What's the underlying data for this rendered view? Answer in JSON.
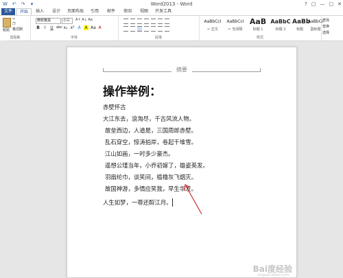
{
  "window": {
    "title": "Word2013 - Word",
    "qat": [
      "W",
      "↶",
      "↷",
      "▾"
    ],
    "controls": [
      "?",
      "▢",
      "—",
      "▢",
      "✕"
    ]
  },
  "tabs": [
    {
      "label": "文件",
      "kind": "file"
    },
    {
      "label": "开始",
      "kind": "active"
    },
    {
      "label": "插入"
    },
    {
      "label": "设计"
    },
    {
      "label": "页面布局"
    },
    {
      "label": "引用"
    },
    {
      "label": "邮件"
    },
    {
      "label": "审阅"
    },
    {
      "label": "视图"
    },
    {
      "label": "开发工具"
    }
  ],
  "ribbon": {
    "clipboard": {
      "paste": "粘贴",
      "cut": "✂",
      "copy": "❐",
      "format_painter": "格式刷",
      "group": "剪贴板"
    },
    "font": {
      "name": "微软雅黑",
      "size": "小三",
      "group": "字体",
      "buttons": [
        "B",
        "I",
        "U",
        "abc",
        "x₂",
        "x²",
        "A",
        "A",
        "Aa",
        "A"
      ]
    },
    "paragraph": {
      "group": "段落"
    },
    "styles": {
      "group": "样式",
      "items": [
        {
          "sample": "AaBbCcI",
          "name": "↵ 正文"
        },
        {
          "sample": "AaBbCcI",
          "name": "↵ 无间隔"
        },
        {
          "sample": "AaB",
          "name": "标题 1"
        },
        {
          "sample": "AaBbC",
          "name": "标题 2"
        },
        {
          "sample": "AaBb",
          "name": "标题"
        },
        {
          "sample": "AaBbCcI",
          "name": "副标题"
        }
      ]
    },
    "editing": [
      "查找",
      "替换",
      "选择",
      "编辑"
    ]
  },
  "document": {
    "header": "摘要",
    "title": "操作举例：",
    "lines": [
      "赤壁怀古",
      "大江东去，浪淘尽，千古风流人物。",
      "故垒西边，人道是，三国周郎赤壁。",
      "乱石穿空，惊涛拍岸，卷起千堆雪。",
      "江山如画，一时多少豪杰。",
      "遥想公瑾当年，小乔初嫁了，雄姿英发。",
      "羽扇纶巾，谈笑间，樯橹灰飞烟灭。",
      "故国神游，多情应笑我，早生华发。",
      "人生如梦，一尊还酹江月。"
    ]
  },
  "watermark": {
    "main": "Bai度经验",
    "sub": "jingyan.baidu.com"
  }
}
